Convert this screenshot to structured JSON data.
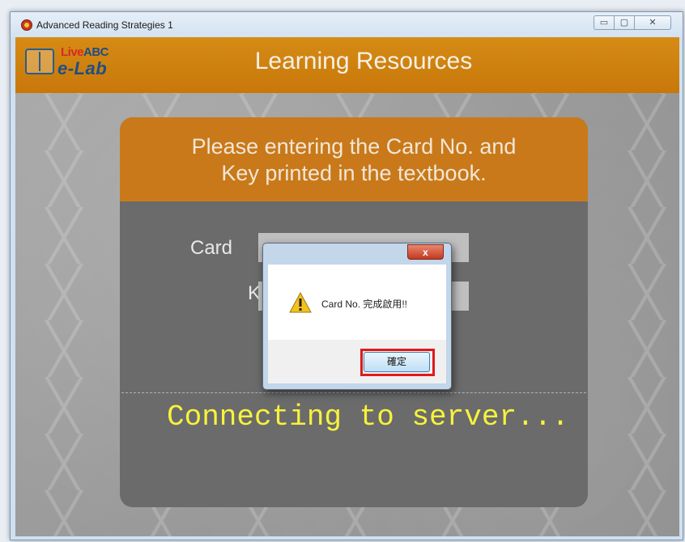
{
  "window": {
    "title": "Advanced Reading Strategies 1",
    "controls": {
      "minimize": "▭",
      "maximize": "▢",
      "close": "✕"
    }
  },
  "header": {
    "logo_live": "Live",
    "logo_abc": "ABC",
    "logo_elab": "e-Lab",
    "title": "Learning Resources"
  },
  "panel": {
    "instruction": "Please entering the Card No. and\nKey printed in the textbook.",
    "card_label": "Card",
    "key_label": "K",
    "status": "Connecting to server..."
  },
  "dialog": {
    "close_label": "x",
    "message": "Card No. 完成啟用!!",
    "ok_label": "確定",
    "icon": "warning-icon"
  },
  "colors": {
    "header": "#c8780a",
    "panel": "#6b6b6b",
    "status_text": "#f7f23c",
    "highlight": "#e01a1a"
  }
}
